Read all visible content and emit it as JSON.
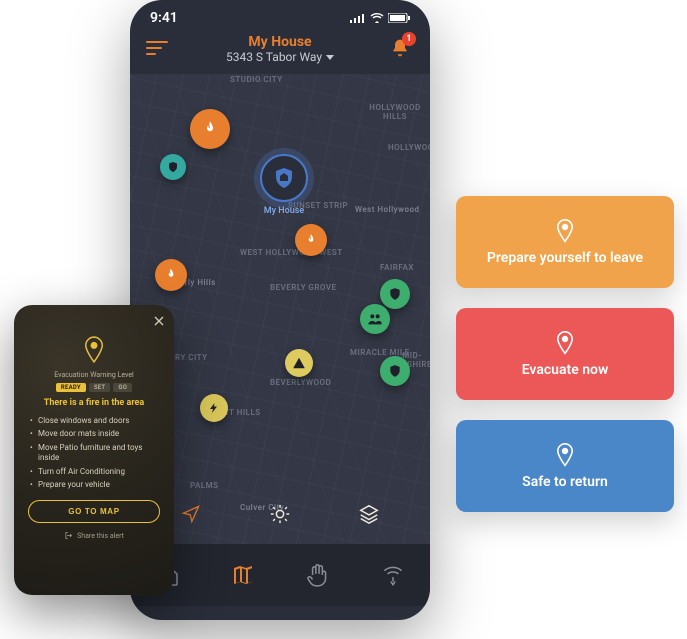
{
  "status": {
    "time": "9:41",
    "notification_count": "1"
  },
  "header": {
    "location_name": "My House",
    "address": "5343 S Tabor Way"
  },
  "map": {
    "house_label": "My House",
    "neighborhoods": [
      "STUDIO CITY",
      "HOLLYWOOD HILLS",
      "HOLLYWOOD",
      "SUNSET STRIP",
      "West Hollywood",
      "WEST HOLLYWOOD WEST",
      "BEVERLY GROVE",
      "FAIRFAX",
      "MIRACLE MILE",
      "MID-WILSHIRE",
      "BEVERLYWOOD",
      "Beverly Hills",
      "RY CITY",
      "VICT HILLS",
      "PALMS",
      "Culver City"
    ]
  },
  "alert_popup": {
    "subtitle": "Evacuation Warning Level",
    "pills": [
      "READY",
      "SET",
      "GO"
    ],
    "title": "There is a fire in the area",
    "checklist": [
      "Close windows and doors",
      "Move door mats inside",
      "Move Patio furniture and toys inside",
      "Turn off Air Conditioning",
      "Prepare your vehicle"
    ],
    "cta": "GO TO MAP",
    "share": "Share this alert"
  },
  "callouts": {
    "prepare": "Prepare yourself to leave",
    "evacuate": "Evacuate now",
    "safe": "Safe to return"
  },
  "icons": {
    "menu": "menu-icon",
    "bell": "bell-icon",
    "fire": "fire-icon",
    "shield": "shield-icon",
    "people": "people-icon",
    "warning": "warning-icon",
    "bolt": "bolt-icon",
    "bright": "brightness-icon",
    "layers": "layers-icon",
    "locate": "locate-icon",
    "tab_home": "home-tab",
    "tab_map": "map-tab",
    "tab_hand": "resources-tab",
    "tab_drone": "sensor-tab",
    "close": "close-icon",
    "share": "share-icon",
    "pin": "location-pin-icon"
  }
}
